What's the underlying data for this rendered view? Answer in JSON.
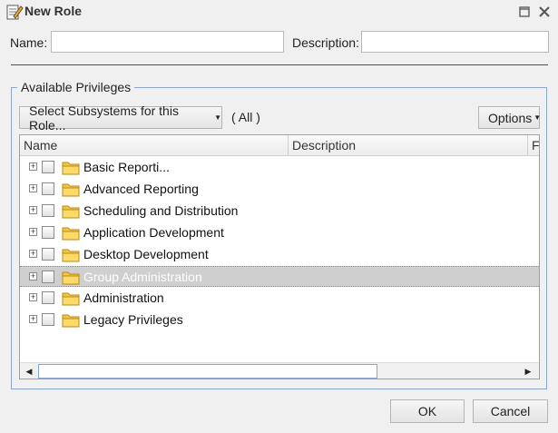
{
  "window": {
    "title": "New Role",
    "icons": [
      "role-edit-icon",
      "maximize-icon",
      "close-icon"
    ]
  },
  "form": {
    "name_label": "Name:",
    "name_value": "",
    "description_label": "Description:",
    "description_value": ""
  },
  "privileges": {
    "legend": "Available Privileges",
    "subsystems_button": "Select Subsystems for this Role...",
    "filter_label": "( All )",
    "options_button": "Options",
    "columns": [
      "Name",
      "Description",
      "Fo"
    ],
    "rows": [
      {
        "label": "Basic Reporti...",
        "checked": false,
        "selected": false
      },
      {
        "label": "Advanced Reporting",
        "checked": false,
        "selected": false
      },
      {
        "label": "Scheduling and Distribution",
        "checked": false,
        "selected": false
      },
      {
        "label": "Application Development",
        "checked": false,
        "selected": false
      },
      {
        "label": "Desktop Development",
        "checked": false,
        "selected": false
      },
      {
        "label": "Group Administration",
        "checked": false,
        "selected": true
      },
      {
        "label": "Administration",
        "checked": false,
        "selected": false
      },
      {
        "label": "Legacy Privileges",
        "checked": false,
        "selected": false
      }
    ]
  },
  "footer": {
    "ok_label": "OK",
    "cancel_label": "Cancel"
  },
  "colors": {
    "accent_border": "#8aa6cf",
    "selected_row": "#cfcfcf",
    "folder_yellow": "#f5c542"
  }
}
